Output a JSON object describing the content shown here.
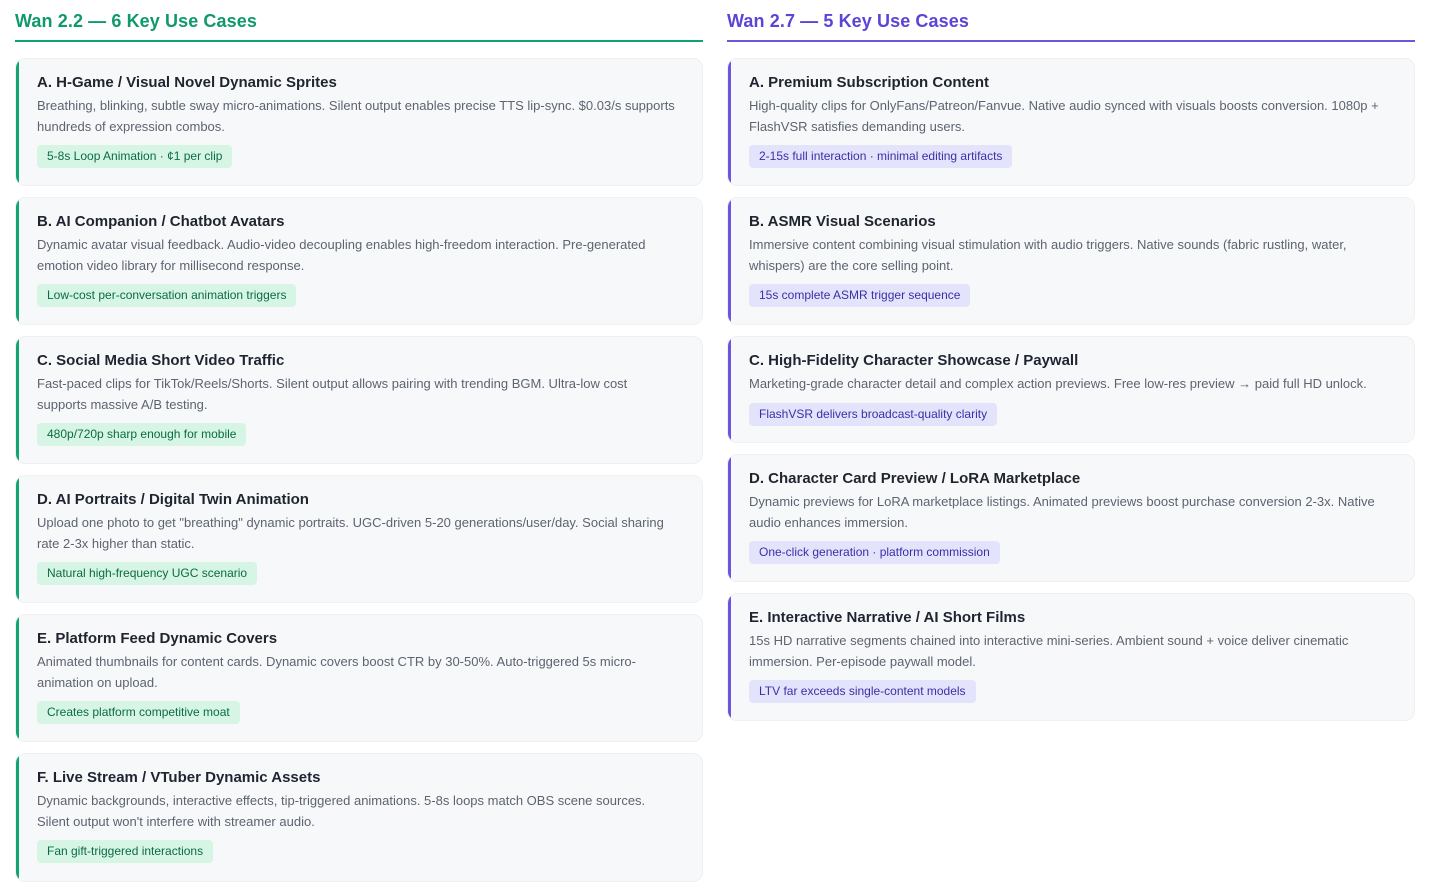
{
  "left": {
    "title": "Wan 2.2 — 6 Key Use Cases",
    "accent": "#10a272",
    "cards": [
      {
        "title": "A. H-Game / Visual Novel Dynamic Sprites",
        "desc": "Breathing, blinking, subtle sway micro-animations. Silent output enables precise TTS lip-sync. $0.03/s supports hundreds of expression combos.",
        "tag": "5-8s Loop Animation · ¢1 per clip"
      },
      {
        "title": "B. AI Companion / Chatbot Avatars",
        "desc": "Dynamic avatar visual feedback. Audio-video decoupling enables high-freedom interaction. Pre-generated emotion video library for millisecond response.",
        "tag": "Low-cost per-conversation animation triggers"
      },
      {
        "title": "C. Social Media Short Video Traffic",
        "desc": "Fast-paced clips for TikTok/Reels/Shorts. Silent output allows pairing with trending BGM. Ultra-low cost supports massive A/B testing.",
        "tag": "480p/720p sharp enough for mobile"
      },
      {
        "title": "D. AI Portraits / Digital Twin Animation",
        "desc": "Upload one photo to get \"breathing\" dynamic portraits. UGC-driven 5-20 generations/user/day. Social sharing rate 2-3x higher than static.",
        "tag": "Natural high-frequency UGC scenario"
      },
      {
        "title": "E. Platform Feed Dynamic Covers",
        "desc": "Animated thumbnails for content cards. Dynamic covers boost CTR by 30-50%. Auto-triggered 5s micro-animation on upload.",
        "tag": "Creates platform competitive moat"
      },
      {
        "title": "F. Live Stream / VTuber Dynamic Assets",
        "desc": "Dynamic backgrounds, interactive effects, tip-triggered animations. 5-8s loops match OBS scene sources. Silent output won't interfere with streamer audio.",
        "tag": "Fan gift-triggered interactions"
      }
    ]
  },
  "right": {
    "title": "Wan 2.7 — 5 Key Use Cases",
    "accent": "#6b56dc",
    "cards": [
      {
        "title": "A. Premium Subscription Content",
        "desc": "High-quality clips for OnlyFans/Patreon/Fanvue. Native audio synced with visuals boosts conversion. 1080p + FlashVSR satisfies demanding users.",
        "tag": "2-15s full interaction · minimal editing artifacts"
      },
      {
        "title": "B. ASMR Visual Scenarios",
        "desc": "Immersive content combining visual stimulation with audio triggers. Native sounds (fabric rustling, water, whispers) are the core selling point.",
        "tag": "15s complete ASMR trigger sequence"
      },
      {
        "title": "C. High-Fidelity Character Showcase / Paywall",
        "desc": "Marketing-grade character detail and complex action previews. Free low-res preview → paid full HD unlock.",
        "tag": "FlashVSR delivers broadcast-quality clarity"
      },
      {
        "title": "D. Character Card Preview / LoRA Marketplace",
        "desc": "Dynamic previews for LoRA marketplace listings. Animated previews boost purchase conversion 2-3x. Native audio enhances immersion.",
        "tag": "One-click generation · platform commission"
      },
      {
        "title": "E. Interactive Narrative / AI Short Films",
        "desc": "15s HD narrative segments chained into interactive mini-series. Ambient sound + voice deliver cinematic immersion. Per-episode paywall model.",
        "tag": "LTV far exceeds single-content models"
      }
    ]
  }
}
